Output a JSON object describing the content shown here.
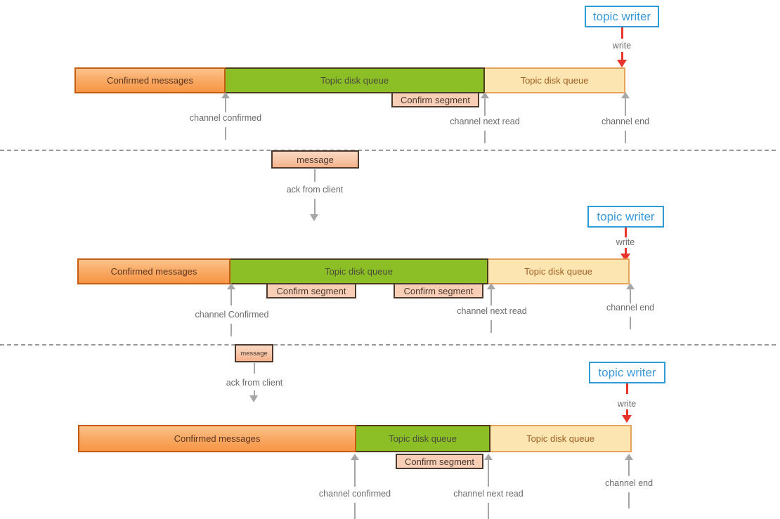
{
  "diagram": {
    "title": "Topic disk queue channel states",
    "colors": {
      "confirmed_fill": "#f79646",
      "confirmed_border": "#c55a11",
      "disk_green_fill": "#8cbf26",
      "disk_green_border": "#4c3a19",
      "disk_yellow_fill": "#fce5b0",
      "disk_yellow_border": "#e8a35a",
      "confirm_segment_fill": "#f8cfb6",
      "confirm_segment_border": "#4c3a2e",
      "message_fill": "#f5b188",
      "writer_border": "#2e9bd6",
      "writer_text": "#3b9ad9",
      "write_arrow": "#e8342a",
      "pointer_grey": "#a6a6a6",
      "divider_grey": "#9a9a9a",
      "label_text": "#6b6b6b"
    },
    "rows": [
      {
        "id": "row-1",
        "writer_label": "topic writer",
        "write_label": "write",
        "segments": [
          {
            "label": "Confirmed messages",
            "kind": "confirmed"
          },
          {
            "label": "Topic disk queue",
            "kind": "disk-green"
          },
          {
            "label": "Topic disk queue",
            "kind": "disk-yellow"
          }
        ],
        "confirm_segments": [
          {
            "label": "Confirm segment"
          }
        ],
        "pointers": [
          {
            "label": "channel confirmed"
          },
          {
            "label": "channel next read"
          },
          {
            "label": "channel end"
          }
        ]
      },
      {
        "id": "row-2",
        "writer_label": "topic writer",
        "write_label": "write",
        "message_label": "message",
        "ack_label": "ack from client",
        "segments": [
          {
            "label": "Confirmed messages",
            "kind": "confirmed"
          },
          {
            "label": "Topic disk queue",
            "kind": "disk-green"
          },
          {
            "label": "Topic disk queue",
            "kind": "disk-yellow"
          }
        ],
        "confirm_segments": [
          {
            "label": "Confirm segment"
          },
          {
            "label": "Confirm segment"
          }
        ],
        "pointers": [
          {
            "label": "channel Confirmed"
          },
          {
            "label": "channel next read"
          },
          {
            "label": "channel end"
          }
        ]
      },
      {
        "id": "row-3",
        "writer_label": "topic writer",
        "write_label": "write",
        "message_label": "message",
        "ack_label": "ack from client",
        "segments": [
          {
            "label": "Confirmed messages",
            "kind": "confirmed"
          },
          {
            "label": "Topic disk queue",
            "kind": "disk-green"
          },
          {
            "label": "Topic disk queue",
            "kind": "disk-yellow"
          }
        ],
        "confirm_segments": [
          {
            "label": "Confirm segment"
          }
        ],
        "pointers": [
          {
            "label": "channel confirmed"
          },
          {
            "label": "channel next read"
          },
          {
            "label": "channel end"
          }
        ]
      }
    ]
  }
}
